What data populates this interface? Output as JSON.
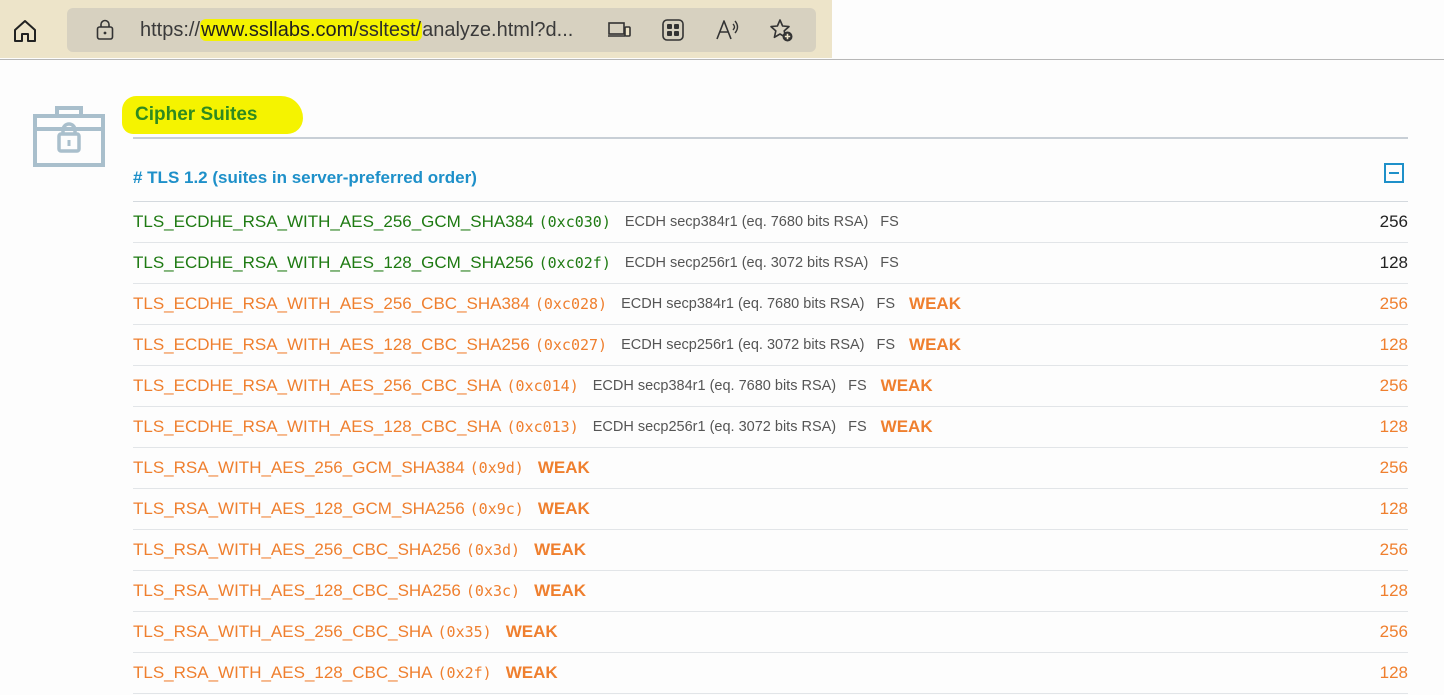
{
  "browser": {
    "url_prefix": "https://",
    "url_domain": "www.ssllabs.com",
    "url_sep": "/",
    "url_path": "ssltest/",
    "url_rest": "analyze.html?d..."
  },
  "section": {
    "title": "Cipher Suites",
    "tls_header": "# TLS 1.2 (suites in server-preferred order)"
  },
  "suites": [
    {
      "name": "TLS_ECDHE_RSA_WITH_AES_256_GCM_SHA384",
      "code": "(0xc030)",
      "kx": "ECDH secp384r1 (eq. 7680 bits RSA)",
      "fs": "FS",
      "weak": "",
      "bits": "256",
      "status": "good"
    },
    {
      "name": "TLS_ECDHE_RSA_WITH_AES_128_GCM_SHA256",
      "code": "(0xc02f)",
      "kx": "ECDH secp256r1 (eq. 3072 bits RSA)",
      "fs": "FS",
      "weak": "",
      "bits": "128",
      "status": "good"
    },
    {
      "name": "TLS_ECDHE_RSA_WITH_AES_256_CBC_SHA384",
      "code": "(0xc028)",
      "kx": "ECDH secp384r1 (eq. 7680 bits RSA)",
      "fs": "FS",
      "weak": "WEAK",
      "bits": "256",
      "status": "warn"
    },
    {
      "name": "TLS_ECDHE_RSA_WITH_AES_128_CBC_SHA256",
      "code": "(0xc027)",
      "kx": "ECDH secp256r1 (eq. 3072 bits RSA)",
      "fs": "FS",
      "weak": "WEAK",
      "bits": "128",
      "status": "warn"
    },
    {
      "name": "TLS_ECDHE_RSA_WITH_AES_256_CBC_SHA",
      "code": "(0xc014)",
      "kx": "ECDH secp384r1 (eq. 7680 bits RSA)",
      "fs": "FS",
      "weak": "WEAK",
      "bits": "256",
      "status": "warn"
    },
    {
      "name": "TLS_ECDHE_RSA_WITH_AES_128_CBC_SHA",
      "code": "(0xc013)",
      "kx": "ECDH secp256r1 (eq. 3072 bits RSA)",
      "fs": "FS",
      "weak": "WEAK",
      "bits": "128",
      "status": "warn"
    },
    {
      "name": "TLS_RSA_WITH_AES_256_GCM_SHA384",
      "code": "(0x9d)",
      "kx": "",
      "fs": "",
      "weak": "WEAK",
      "bits": "256",
      "status": "warn"
    },
    {
      "name": "TLS_RSA_WITH_AES_128_GCM_SHA256",
      "code": "(0x9c)",
      "kx": "",
      "fs": "",
      "weak": "WEAK",
      "bits": "128",
      "status": "warn"
    },
    {
      "name": "TLS_RSA_WITH_AES_256_CBC_SHA256",
      "code": "(0x3d)",
      "kx": "",
      "fs": "",
      "weak": "WEAK",
      "bits": "256",
      "status": "warn"
    },
    {
      "name": "TLS_RSA_WITH_AES_128_CBC_SHA256",
      "code": "(0x3c)",
      "kx": "",
      "fs": "",
      "weak": "WEAK",
      "bits": "128",
      "status": "warn"
    },
    {
      "name": "TLS_RSA_WITH_AES_256_CBC_SHA",
      "code": "(0x35)",
      "kx": "",
      "fs": "",
      "weak": "WEAK",
      "bits": "256",
      "status": "warn"
    },
    {
      "name": "TLS_RSA_WITH_AES_128_CBC_SHA",
      "code": "(0x2f)",
      "kx": "",
      "fs": "",
      "weak": "WEAK",
      "bits": "128",
      "status": "warn"
    }
  ],
  "icons": {
    "home": "home-icon",
    "lock": "lock-icon",
    "devices": "devices-icon",
    "apps": "apps-icon",
    "read_aloud": "read-aloud-icon",
    "favorites": "add-favorite-icon",
    "section": "toolbox-lock-icon",
    "collapse": "collapse-icon"
  },
  "colors": {
    "strong": "#1e7a12",
    "weak": "#ef7f2e",
    "header": "#1e90c9",
    "highlight": "#f5f300"
  }
}
